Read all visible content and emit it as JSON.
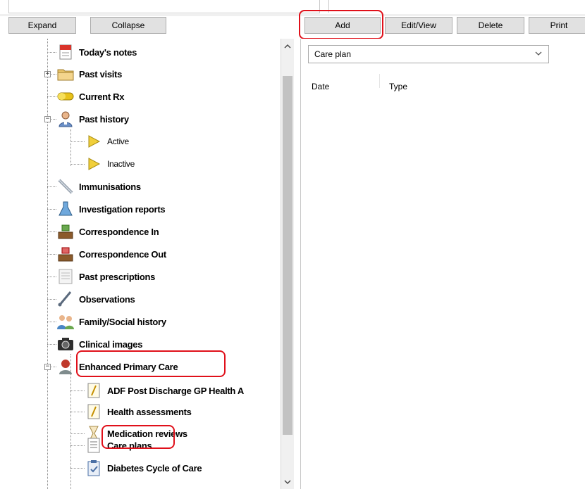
{
  "toolbar_left": {
    "expand_label": "Expand",
    "collapse_label": "Collapse"
  },
  "toolbar_right": {
    "add_label": "Add",
    "editview_label": "Edit/View",
    "delete_label": "Delete",
    "print_label": "Print"
  },
  "tree": {
    "items": [
      {
        "label": "Today's notes",
        "icon": "notes-icon"
      },
      {
        "label": "Past visits",
        "icon": "folder-icon"
      },
      {
        "label": "Current Rx",
        "icon": "pill-icon"
      },
      {
        "label": "Past history",
        "icon": "doctor-icon"
      },
      {
        "label": "Active",
        "icon": "triangle-icon"
      },
      {
        "label": "Inactive",
        "icon": "triangle-icon"
      },
      {
        "label": "Immunisations",
        "icon": "syringe-icon"
      },
      {
        "label": "Investigation reports",
        "icon": "flask-icon"
      },
      {
        "label": "Correspondence In",
        "icon": "inbox-icon"
      },
      {
        "label": "Correspondence Out",
        "icon": "outbox-icon"
      },
      {
        "label": "Past prescriptions",
        "icon": "prescription-icon"
      },
      {
        "label": "Observations",
        "icon": "thermometer-icon"
      },
      {
        "label": "Family/Social history",
        "icon": "family-icon"
      },
      {
        "label": "Clinical images",
        "icon": "camera-icon"
      },
      {
        "label": "Enhanced Primary Care",
        "icon": "epc-icon"
      },
      {
        "label": "ADF Post Discharge GP Health A",
        "icon": "form-icon"
      },
      {
        "label": "Health assessments",
        "icon": "form-icon"
      },
      {
        "label": "Medication reviews",
        "icon": "hourglass-icon"
      },
      {
        "label": "Care plans",
        "icon": "document-icon"
      },
      {
        "label": "Diabetes Cycle of Care",
        "icon": "clipboard-icon"
      }
    ]
  },
  "right_pane": {
    "filter_value": "Care plan",
    "columns": [
      "Date",
      "Type"
    ]
  },
  "colors": {
    "annotation": "#e0101a",
    "button_bg": "#e1e1e1",
    "scroll_thumb": "#c2c2c2"
  }
}
